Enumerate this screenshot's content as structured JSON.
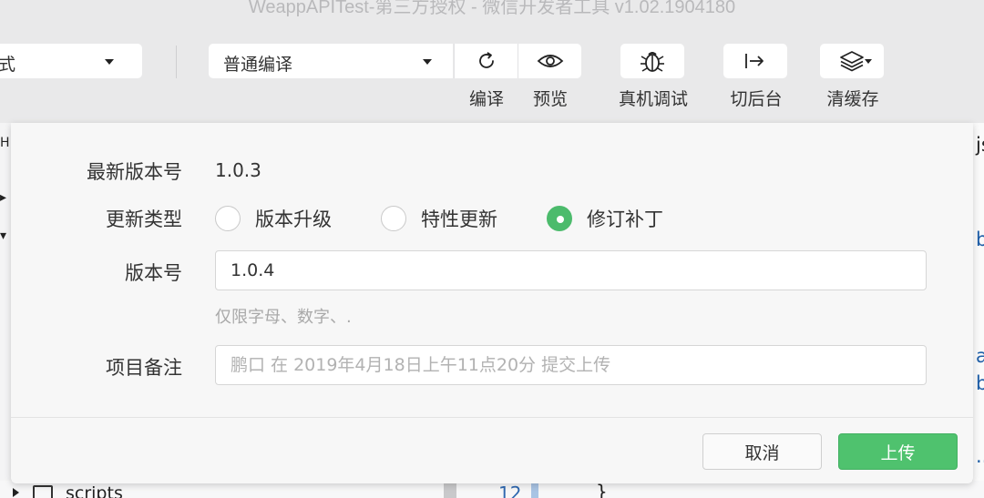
{
  "window": {
    "title": "WeappAPITest-第三方授权 - 微信开发者工具 v1.02.1904180"
  },
  "toolbar": {
    "mode_select_value": "式",
    "compile_select_value": "普通编译",
    "buttons": [
      {
        "label": "编译",
        "icon": "refresh-icon"
      },
      {
        "label": "预览",
        "icon": "eye-icon"
      },
      {
        "label": "真机调试",
        "icon": "bug-icon"
      },
      {
        "label": "切后台",
        "icon": "switch-background-icon"
      },
      {
        "label": "清缓存",
        "icon": "layers-icon"
      }
    ]
  },
  "background": {
    "left_glyphs": [
      "H",
      "▸",
      "▾"
    ],
    "right_glyphs": [
      "js",
      "b",
      "a",
      "b",
      "..."
    ],
    "tree_item": "scripts",
    "line_number": "12",
    "code_char": "}"
  },
  "dialog": {
    "latest_version_label": "最新版本号",
    "latest_version_value": "1.0.3",
    "update_type_label": "更新类型",
    "update_types": [
      {
        "label": "版本升级",
        "checked": false
      },
      {
        "label": "特性更新",
        "checked": false
      },
      {
        "label": "修订补丁",
        "checked": true
      }
    ],
    "version_label": "版本号",
    "version_value": "1.0.4",
    "version_hint": "仅限字母、数字、.",
    "remark_label": "项目备注",
    "remark_placeholder": "鹏口 在 2019年4月18日上午11点20分 提交上传",
    "cancel_label": "取消",
    "upload_label": "上传"
  },
  "colors": {
    "accent_green": "#4fc26e",
    "link_blue": "#1f5fa8"
  }
}
